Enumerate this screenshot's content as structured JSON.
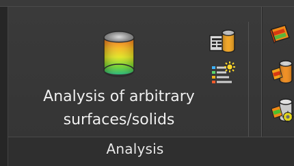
{
  "ribbon": {
    "panel_title": "Analysis",
    "tools": {
      "large": {
        "label_line1": "Analysis of arbitrary",
        "label_line2": "surfaces/solids",
        "icon": "colored-cylinder-icon"
      },
      "small": [
        {
          "icon": "cylinder-report-icon"
        },
        {
          "icon": "legend-list-icon"
        }
      ],
      "right_column": [
        {
          "icon": "orange-box-icon"
        },
        {
          "icon": "cylinder-orange-icon"
        },
        {
          "icon": "cylinder-gear-icon"
        }
      ]
    }
  },
  "colors": {
    "panel_bg": "#353535",
    "footer_bg": "#2f2f2f",
    "text": "#efefef",
    "divider": "#5a5a5a",
    "accent_orange": "#f08a18",
    "accent_red": "#d73a12",
    "accent_yellow": "#e4d61c",
    "accent_green": "#4bbf2f"
  }
}
